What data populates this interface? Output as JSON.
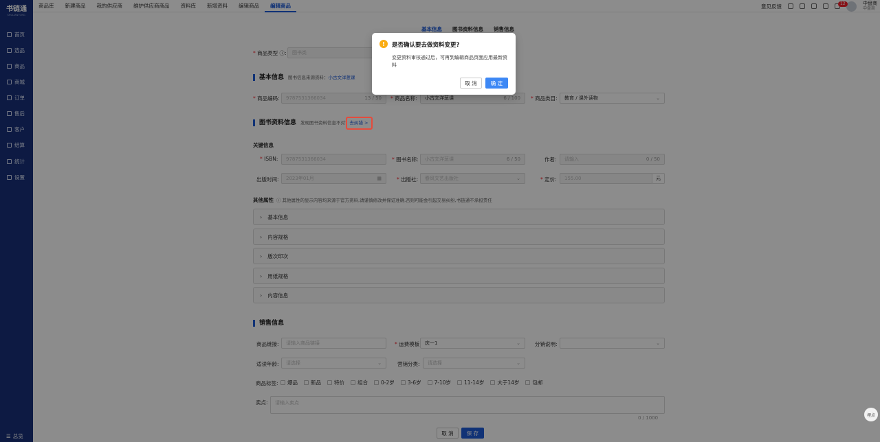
{
  "brand": {
    "name": "书链通",
    "sub": "SHULIANTONG"
  },
  "sidebar": {
    "items": [
      "首页",
      "选品",
      "商品",
      "商城",
      "订单",
      "售后",
      "客户",
      "结算",
      "统计",
      "设置"
    ],
    "bottom": "总览"
  },
  "topbar": {
    "tabs": [
      "商品库",
      "新建商品",
      "我的供应商",
      "维护供应商商品",
      "资料库",
      "新增资料",
      "编辑商品",
      "编辑商品"
    ],
    "active_index": 7,
    "feedback": "意见反馈",
    "badge": "12",
    "user_name": "中盘商",
    "user_role": "中盘商"
  },
  "section_tabs": [
    "基本信息",
    "图书资料信息",
    "销售信息"
  ],
  "product_type": {
    "label": "商品类型",
    "value": "图书类"
  },
  "basic": {
    "title": "基本信息",
    "source_hint": "图书信息来源资料：",
    "source_link": "小古文洋葱课",
    "code_label": "商品编码",
    "code_value": "9787531366034",
    "code_count": "13 / 50",
    "name_label": "商品名称",
    "name_value": "小古文洋葱课",
    "name_count": "6 / 100",
    "category_label": "商品类目",
    "category_value": "教育 / 课外读物"
  },
  "book": {
    "title": "图书资料信息",
    "hint": "发现图书资料信息不对?",
    "link": "去纠错 >",
    "key_title": "关键信息",
    "isbn_label": "ISBN",
    "isbn_value": "9787531366034",
    "bname_label": "图书名称",
    "bname_value": "小古文洋葱课",
    "bname_count": "6 / 50",
    "author_label": "作者",
    "author_placeholder": "请输入",
    "author_count": "0 / 50",
    "date_label": "出版时间",
    "date_value": "2023年01月",
    "publisher_label": "出版社",
    "publisher_value": "春风文艺出版社",
    "price_label": "定价",
    "price_value": "155.00",
    "price_unit": "元",
    "other_title": "其他属性",
    "other_hint": "其他属性的显示内容均来源于官方资料,请谨慎修改并保证准确,否则可能会引起交易纠纷,书链通不承担责任",
    "panels": [
      "基本信息",
      "内容规格",
      "版次印次",
      "用纸规格",
      "内容信息"
    ]
  },
  "sales": {
    "title": "销售信息",
    "link_label": "商品链接",
    "link_placeholder": "请输入商品链接",
    "ship_label": "运费模板",
    "ship_value": "庆一1",
    "dist_label": "分销说明",
    "age_label": "适读年龄",
    "age_placeholder": "请选择",
    "mkt_label": "营销分类",
    "mkt_placeholder": "请选择",
    "tags_label": "商品标签",
    "tags": [
      "爆品",
      "新品",
      "特价",
      "组合",
      "0-2岁",
      "3-6岁",
      "7-10岁",
      "11-14岁",
      "大于14岁",
      "包邮"
    ],
    "selling_label": "卖点",
    "selling_placeholder": "请输入卖点",
    "selling_count": "0 / 1000"
  },
  "actions": {
    "cancel": "取 消",
    "save": "保 存"
  },
  "collect": "埋点",
  "modal": {
    "title": "是否确认要去做资料变更?",
    "content": "变更资料审核通过后，可再到编辑商品页面应用最新资料",
    "cancel": "取 消",
    "ok": "确 定"
  }
}
